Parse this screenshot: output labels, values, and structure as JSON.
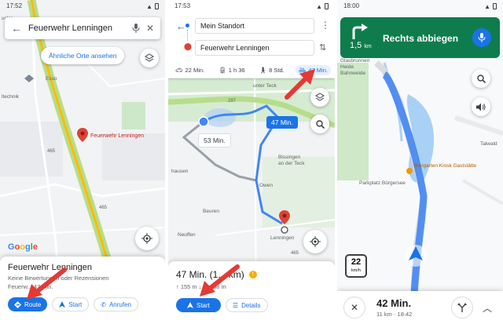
{
  "screen1": {
    "status_time": "17:52",
    "search_query": "Feuerwehr Lenningen",
    "chip_label": "Ähnliche Orte ansehen",
    "map_labels": {
      "esso": "Esso",
      "usler": "usler",
      "ltechnik": "ltechnik",
      "marker": "Feuerwehr Lenningen",
      "road465a": "465",
      "road465b": "465",
      "google": "Google"
    },
    "sheet": {
      "title": "Feuerwehr Lenningen",
      "subtitle": "Keine Bewertungen oder Rezensionen",
      "info": "Feuerw... 47 Min.",
      "route_label": "Route",
      "start_label": "Start",
      "call_label": "Anrufen"
    }
  },
  "screen2": {
    "status_time": "17:53",
    "from": "Mein Standort",
    "to": "Feuerwehr Lenningen",
    "modes": [
      {
        "icon": "car-icon",
        "label": "22 Min.",
        "selected": false
      },
      {
        "icon": "transit-icon",
        "label": "1 h 36",
        "selected": false
      },
      {
        "icon": "walk-icon",
        "label": "8 Std.",
        "selected": false
      },
      {
        "icon": "bike-icon",
        "label": "47 Min.",
        "selected": true
      }
    ],
    "callout_main": "47 Min.",
    "callout_alt": "53 Min.",
    "map_labels": {
      "teck": "unter Teck",
      "bissingen": "Bissingen",
      "anderteck": "an der Teck",
      "owen": "Owen",
      "beuren": "Beuren",
      "neuffen": "Neuffen",
      "lenningen": "Lenningen",
      "hausen": "hausen",
      "r297": "297",
      "r465": "465"
    },
    "sheet": {
      "duration": "47 Min. (1... km)",
      "detail": "↑ 155 m  ↓ 1... 58 m",
      "start_label": "Start",
      "details_label": "Details"
    }
  },
  "screen3": {
    "status_time": "18:00",
    "maneuver": "Rechts abbiegen",
    "distance": "1,5",
    "distance_unit": "km",
    "map_labels": {
      "glasbrunnen": "Glasbrunnen",
      "bahnweide": "Bahnweide",
      "heide": "Heide",
      "biergarten": "Biergarten Kiosk Gaststätte",
      "parkplatz": "Parkplatz Bürgersee",
      "talwald": "Talwald"
    },
    "speed_limit": "22",
    "speed_unit": "km/h",
    "eta_duration": "42 Min.",
    "eta_detail": "11 km · 18:42"
  },
  "colors": {
    "route_blue": "#4285f4",
    "nav_green": "#0f7c4e",
    "pin_red": "#db4437",
    "arrow_red": "#e53935",
    "primary": "#1a73e8"
  }
}
